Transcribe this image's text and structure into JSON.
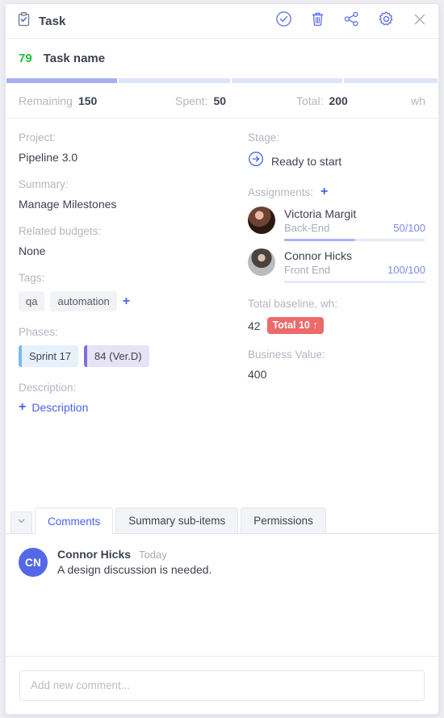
{
  "window": {
    "title": "Task",
    "title_icon": "clipboard-check-icon",
    "actions": [
      {
        "name": "approve-button",
        "icon": "check-circle-icon"
      },
      {
        "name": "delete-button",
        "icon": "trash-icon"
      },
      {
        "name": "share-button",
        "icon": "share-icon"
      },
      {
        "name": "settings-button",
        "icon": "gear-icon"
      },
      {
        "name": "close-button",
        "icon": "close-icon"
      }
    ]
  },
  "task": {
    "number": "79",
    "name": "Task name"
  },
  "progress": {
    "segments": [
      {
        "filled": true
      },
      {
        "filled": false
      },
      {
        "filled": false
      },
      {
        "filled": false
      }
    ],
    "fill_color": "#a7afee",
    "track_color": "#e0e4f9"
  },
  "metrics": {
    "remaining_label": "Remaining",
    "remaining_value": "150",
    "spent_label": "Spent:",
    "spent_value": "50",
    "total_label": "Total:",
    "total_value": "200",
    "unit": "wh"
  },
  "left": {
    "project_label": "Project:",
    "project_value": "Pipeline 3.0",
    "summary_label": "Summary:",
    "summary_value": "Manage Milestones",
    "budgets_label": "Related budgets:",
    "budgets_value": "None",
    "tags_label": "Tags:",
    "tags": [
      "qa",
      "automation"
    ],
    "tags_add": "+",
    "phases_label": "Phases:",
    "phases": [
      {
        "label": "Sprint 17",
        "color": "#7ab9f5"
      },
      {
        "label": "84 (Ver.D)",
        "color": "#7b72d8"
      }
    ],
    "description_label": "Description:",
    "description_add_icon": "+",
    "description_link": "Description"
  },
  "right": {
    "stage_label": "Stage:",
    "stage_value": "Ready to start",
    "stage_icon": "arrow-right-circle-icon",
    "assignments_label": "Assignments:",
    "assignments_add": "+",
    "assignees": [
      {
        "name": "Victoria Margit",
        "role": "Back-End",
        "count": "50/100",
        "percent": 50
      },
      {
        "name": "Connor Hicks",
        "role": "Front End",
        "count": "100/100",
        "percent": 0
      }
    ],
    "baseline_label": "Total baseline, wh:",
    "baseline_value": "42",
    "baseline_badge": "Total 10 ↑",
    "baseline_badge_color": "#ed6a6a",
    "business_value_label": "Business Value:",
    "business_value": "400"
  },
  "tabs": {
    "toggle_icon": "chevron-down-icon",
    "items": [
      {
        "label": "Comments",
        "active": true
      },
      {
        "label": "Summary sub-items",
        "active": false
      },
      {
        "label": "Permissions",
        "active": false
      }
    ]
  },
  "comments": {
    "list": [
      {
        "initials": "CN",
        "author": "Connor Hicks",
        "time": "Today",
        "text": "A design discussion is needed."
      }
    ],
    "composer_placeholder": "Add new comment...",
    "composer_value": ""
  }
}
